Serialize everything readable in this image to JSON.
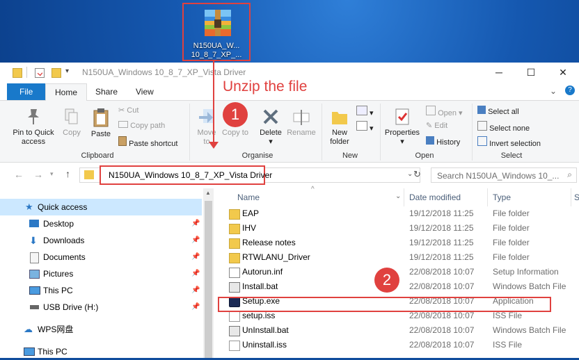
{
  "desktop": {
    "icon_label_line1": "N150UA_W...",
    "icon_label_line2": "10_8_7_XP_..."
  },
  "window": {
    "title": "N150UA_Windows 10_8_7_XP_Vista Driver"
  },
  "tabs": [
    "File",
    "Home",
    "Share",
    "View"
  ],
  "ribbon": {
    "pin_label": "Pin to Quick access",
    "copy_label": "Copy",
    "paste_label": "Paste",
    "cut_label": "Cut",
    "copy_path_label": "Copy path",
    "paste_shortcut_label": "Paste shortcut",
    "clipboard_group": "Clipboard",
    "move_to_label": "Move to",
    "copy_to_label": "Copy to",
    "delete_label": "Delete",
    "rename_label": "Rename",
    "organise_group": "Organise",
    "new_folder_label": "New folder",
    "new_group": "New",
    "properties_label": "Properties",
    "open_label": "Open",
    "edit_label": "Edit",
    "history_label": "History",
    "open_group": "Open",
    "select_all_label": "Select all",
    "select_none_label": "Select none",
    "invert_selection_label": "Invert selection",
    "select_group": "Select"
  },
  "address": {
    "path": "N150UA_Windows 10_8_7_XP_Vista Driver",
    "search_placeholder": "Search N150UA_Windows 10_..."
  },
  "nav": {
    "items": [
      {
        "label": "Quick access",
        "icon": "star-icon"
      },
      {
        "label": "Desktop",
        "icon": "desktop-icon"
      },
      {
        "label": "Downloads",
        "icon": "download-icon"
      },
      {
        "label": "Documents",
        "icon": "documents-icon"
      },
      {
        "label": "Pictures",
        "icon": "pictures-icon"
      },
      {
        "label": "This PC",
        "icon": "computer-icon"
      },
      {
        "label": "USB Drive (H:)",
        "icon": "usb-drive-icon"
      },
      {
        "label": "WPS网盘",
        "icon": "cloud-icon"
      },
      {
        "label": "This PC",
        "icon": "computer-icon"
      }
    ]
  },
  "columns": {
    "name": "Name",
    "date": "Date modified",
    "type": "Type",
    "size": "S"
  },
  "files": [
    {
      "name": "EAP",
      "date": "19/12/2018 11:25",
      "type": "File folder",
      "icon": "folder-icon"
    },
    {
      "name": "IHV",
      "date": "19/12/2018 11:25",
      "type": "File folder",
      "icon": "folder-icon"
    },
    {
      "name": "Release notes",
      "date": "19/12/2018 11:25",
      "type": "File folder",
      "icon": "folder-icon"
    },
    {
      "name": "RTWLANU_Driver",
      "date": "19/12/2018 11:25",
      "type": "File folder",
      "icon": "folder-icon"
    },
    {
      "name": "Autorun.inf",
      "date": "22/08/2018 10:07",
      "type": "Setup Information",
      "icon": "settings-file-icon"
    },
    {
      "name": "Install.bat",
      "date": "22/08/2018 10:07",
      "type": "Windows Batch File",
      "icon": "batch-file-icon"
    },
    {
      "name": "Setup.exe",
      "date": "22/08/2018 10:07",
      "type": "Application",
      "icon": "application-icon"
    },
    {
      "name": "setup.iss",
      "date": "22/08/2018 10:07",
      "type": "ISS File",
      "icon": "file-icon"
    },
    {
      "name": "UnInstall.bat",
      "date": "22/08/2018 10:07",
      "type": "Windows Batch File",
      "icon": "batch-file-icon"
    },
    {
      "name": "Uninstall.iss",
      "date": "22/08/2018 10:07",
      "type": "ISS File",
      "icon": "file-icon"
    }
  ],
  "annotations": {
    "callout": "Unzip the file",
    "step1": "1",
    "step2": "2",
    "color": "#e0413f"
  }
}
